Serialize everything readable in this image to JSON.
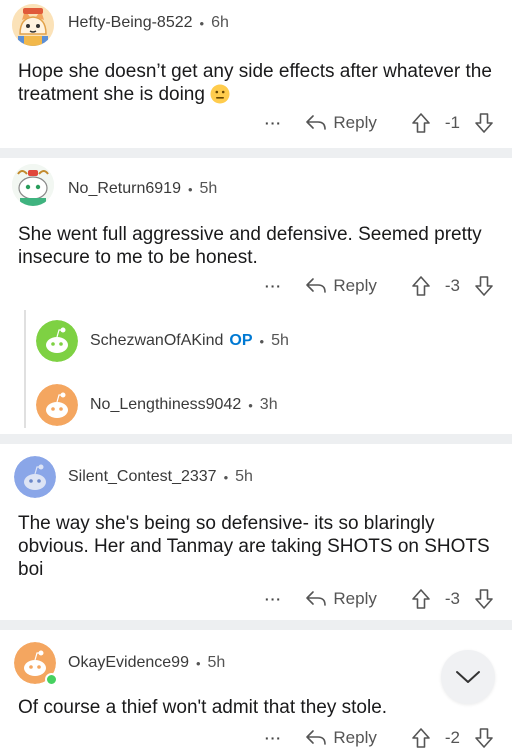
{
  "actions": {
    "more": "···",
    "reply": "Reply"
  },
  "comments": [
    {
      "user": "Hefty-Being-8522",
      "time": "6h",
      "body": "Hope she doesn’t get any side effects after whatever the treatment she is doing",
      "emoji": "neutral-face-emoji",
      "score": "-1"
    },
    {
      "user": "No_Return6919",
      "time": "5h",
      "body": "She went full aggressive and defensive. Seemed pretty insecure to me to be honest.",
      "score": "-3"
    },
    {
      "user": "SchezwanOfAKind",
      "op": "OP",
      "time": "5h",
      "collapsed": true
    },
    {
      "user": "No_Lengthiness9042",
      "time": "3h",
      "collapsed": true
    },
    {
      "user": "Silent_Contest_2337",
      "time": "5h",
      "body": "The way she's being so defensive- its so blaringly obvious. Her and Tanmay are taking SHOTS on SHOTS boi",
      "score": "-3"
    },
    {
      "user": "OkayEvidence99",
      "time": "5h",
      "body": "Of course a thief won't admit that they stole.",
      "score": "-2"
    }
  ],
  "separator": "•",
  "icons": {
    "reply": "reply-arrow-icon",
    "upvote": "upvote-arrow-icon",
    "downvote": "downvote-arrow-icon",
    "collapse": "chevron-down-icon"
  },
  "colors": {
    "op": "#0079d3",
    "divider": "#edeff1",
    "text": "#1a1a1b"
  }
}
